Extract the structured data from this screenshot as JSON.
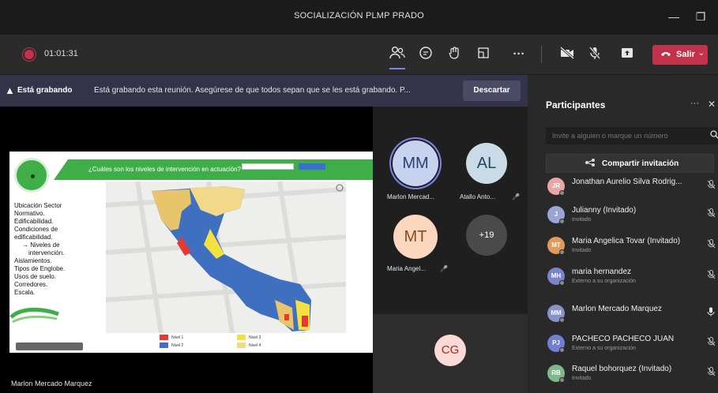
{
  "window": {
    "title": "SOCIALIZACIÓN PLMP PRADO",
    "minimize_glyph": "—",
    "maximize_glyph": "❐"
  },
  "toolbar": {
    "timer": "01:01:31",
    "leave_label": "Salir",
    "icons": [
      "participants-icon",
      "chat-icon",
      "reactions-icon",
      "rooms-icon",
      "more-icon",
      "camera-off-icon",
      "mic-off-icon",
      "share-icon",
      "phone-icon"
    ],
    "more_glyph": "···"
  },
  "banner": {
    "bold": "Está grabando",
    "message": "Está grabando esta reunión. Asegúrese de que todos sepan que se les está grabando. P...",
    "dismiss_label": "Descartar"
  },
  "stage": {
    "presenter_name": "Marlon Mercado Marquez",
    "slide": {
      "question": "¿Cuáles son los niveles de intervención en actuación?",
      "list": [
        "Ubicación Sector",
        "Normativo.",
        "Edificabilidad.",
        "Condiciones de",
        "edificabilidad.",
        "→ Niveles de",
        "intervención.",
        "Aislamientos.",
        "Tipos de Englobe.",
        "Usos de suelo.",
        "Corredores.",
        "Escala."
      ],
      "legend": [
        "Nivel 1",
        "Nivel 2",
        "Nivel 3",
        "Nivel 4"
      ],
      "legend_colors": [
        "#e53935",
        "#3f6fbf",
        "#f5e042",
        "#f2d98a"
      ]
    }
  },
  "tiles": [
    {
      "initials": "MM",
      "name": "Marlon Mercad...",
      "bg": "#c7d2ef",
      "fg": "#2b3f74",
      "muted": false,
      "active": true
    },
    {
      "initials": "AL",
      "name": "Atallo Anto...",
      "bg": "#c9dbe7",
      "fg": "#24475d",
      "muted": true,
      "active": false
    },
    {
      "initials": "MT",
      "name": "Maria Angel...",
      "bg": "#fbd7c0",
      "fg": "#8a4a1e",
      "muted": true,
      "active": false
    },
    {
      "initials": "+19",
      "name": "",
      "bg": "#4a4a4a",
      "fg": "#ffffff",
      "muted": false,
      "active": false
    }
  ],
  "cg_tile": {
    "initials": "CG",
    "bg": "#fbd9d6",
    "fg": "#9d2a2a"
  },
  "panel": {
    "title": "Participantes",
    "more_glyph": "···",
    "close_glyph": "✕",
    "invite_placeholder": "Invite a alguien o marque un número",
    "share_label": "Compartir invitación",
    "participants": [
      {
        "initials": "JR",
        "name": "Jonathan Aurelio Silva Rodrig...",
        "sub": "",
        "bg": "#e9a6a6",
        "mic": "muted"
      },
      {
        "initials": "J",
        "name": "Julianny (Invitado)",
        "sub": "Invitado",
        "bg": "#9aa5d6",
        "mic": "muted"
      },
      {
        "initials": "MT",
        "name": "Maria Angelica Tovar (Invitado)",
        "sub": "Invitado",
        "bg": "#e39b5c",
        "mic": "muted"
      },
      {
        "initials": "MH",
        "name": "maria hernandez",
        "sub": "Externo a su organización",
        "bg": "#7a84c9",
        "mic": "muted"
      },
      {
        "initials": "MM",
        "name": "Marlon Mercado Marquez",
        "sub": "",
        "bg": "#8792c9",
        "mic": "on"
      },
      {
        "initials": "PJ",
        "name": "PACHECO PACHECO JUAN",
        "sub": "Externo a su organización",
        "bg": "#6f7fd6",
        "mic": "muted"
      },
      {
        "initials": "RB",
        "name": "Raquel bohorquez (Invitado)",
        "sub": "Invitado",
        "bg": "#7fb88a",
        "mic": "muted"
      }
    ]
  },
  "colors": {
    "accent": "#7b83eb",
    "leave": "#c4314b",
    "banner": "#33344a",
    "slide_green": "#3fae49"
  }
}
